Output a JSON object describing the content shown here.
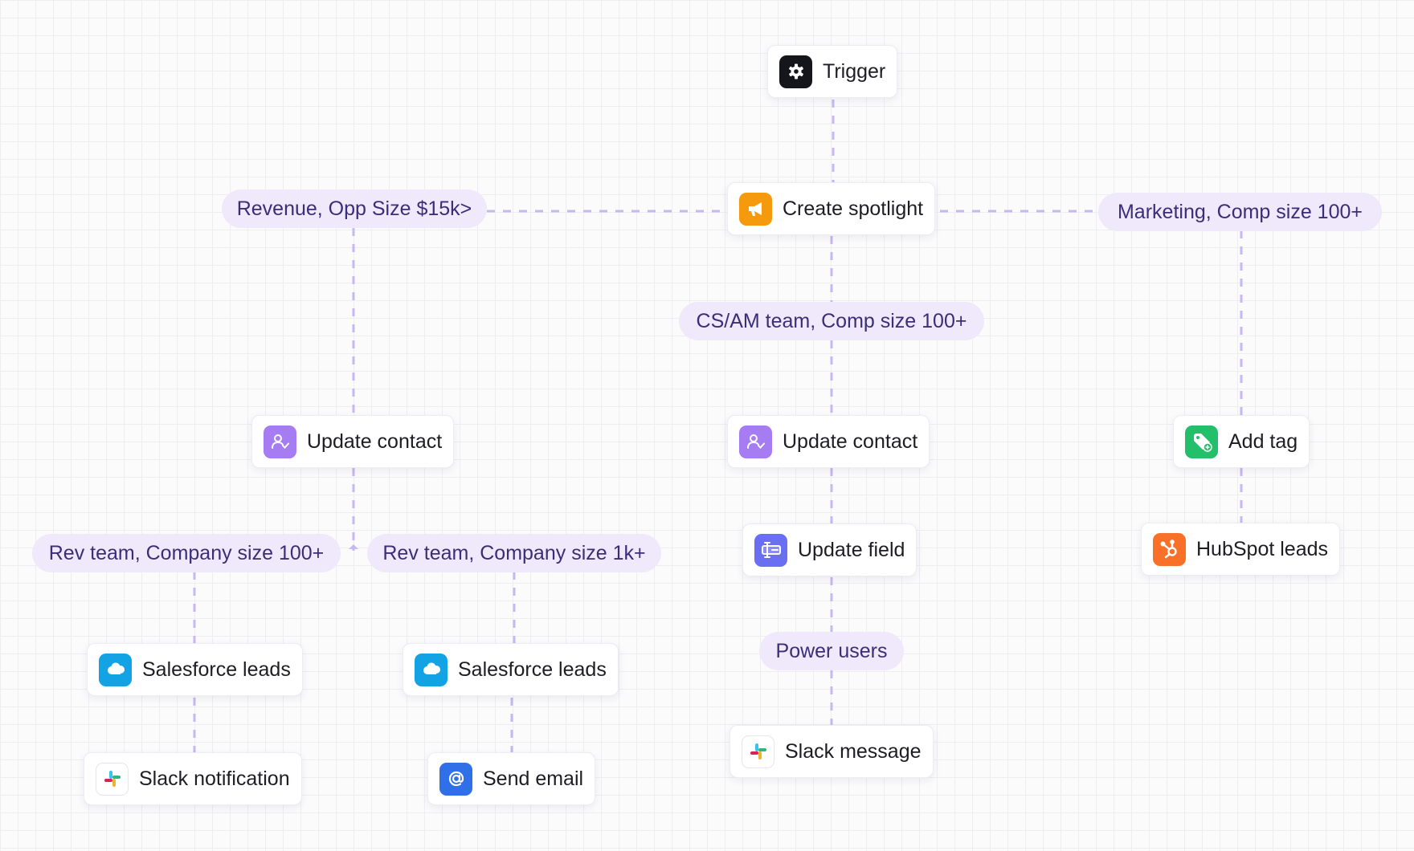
{
  "nodes": {
    "trigger": {
      "label": "Trigger",
      "icon": "gear-icon",
      "icon_bg": "#15161c"
    },
    "create_spotlight": {
      "label": "Create spotlight",
      "icon": "megaphone-icon",
      "icon_bg": "#f59a0c"
    },
    "update_contact_left": {
      "label": "Update contact",
      "icon": "user-check-icon",
      "icon_bg": "#a57cf1"
    },
    "update_contact_mid": {
      "label": "Update contact",
      "icon": "user-check-icon",
      "icon_bg": "#a57cf1"
    },
    "add_tag": {
      "label": "Add tag",
      "icon": "tag-icon",
      "icon_bg": "#23c06b"
    },
    "update_field": {
      "label": "Update field",
      "icon": "text-field-icon",
      "icon_bg": "#6a6ef2"
    },
    "hubspot_leads": {
      "label": "HubSpot leads",
      "icon": "hubspot-icon",
      "icon_bg": "#f97128"
    },
    "salesforce_leads_1": {
      "label": "Salesforce leads",
      "icon": "salesforce-cloud-icon",
      "icon_bg": "#13a3e5"
    },
    "salesforce_leads_2": {
      "label": "Salesforce leads",
      "icon": "salesforce-cloud-icon",
      "icon_bg": "#13a3e5"
    },
    "slack_notification": {
      "label": "Slack notification",
      "icon": "slack-icon",
      "icon_bg": "#ffffff"
    },
    "send_email": {
      "label": "Send email",
      "icon": "at-sign-icon",
      "icon_bg": "#2f6fe8"
    },
    "slack_message": {
      "label": "Slack message",
      "icon": "slack-icon",
      "icon_bg": "#ffffff"
    }
  },
  "conditions": {
    "revenue": "Revenue, Opp Size $15k>",
    "marketing": "Marketing, Comp size 100+",
    "cs_am": "CS/AM team, Comp size 100+",
    "rev_100": "Rev team, Company size 100+",
    "rev_1k": "Rev team, Company size 1k+",
    "power_users": "Power users"
  },
  "colors": {
    "connector": "#c6b8f2",
    "pill_bg": "#efe9fb",
    "pill_text": "#3b2e78"
  }
}
